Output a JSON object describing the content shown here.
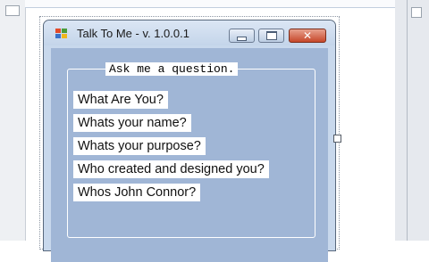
{
  "window": {
    "title": "Talk To Me - v. 1.0.0.1",
    "close_glyph": "✕"
  },
  "group": {
    "title": "Ask me a question."
  },
  "questions": [
    "What Are You?",
    "Whats your name?",
    "Whats your purpose?",
    "Who created and designed you?",
    "Whos John Connor?"
  ],
  "icons": {
    "app": "app-icon",
    "minimize": "minimize-icon",
    "maximize": "maximize-icon",
    "close": "close-icon"
  },
  "colors": {
    "form_background": "#a0b6d6",
    "window_frame": "#c8d8ec",
    "close_button": "#c6472a",
    "label_background": "#ffffff"
  }
}
